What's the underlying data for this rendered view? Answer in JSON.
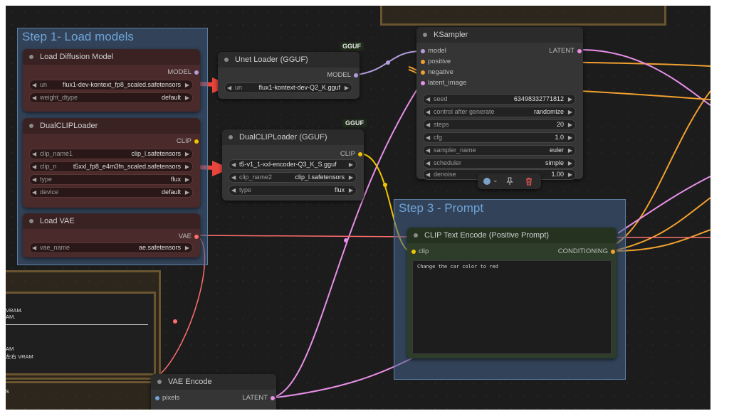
{
  "groups": {
    "step1": "Step 1- Load models",
    "step3": "Step 3 - Prompt"
  },
  "load_diffusion": {
    "title": "Load Diffusion Model",
    "output": "MODEL",
    "unet_label": "un",
    "unet_value": "flux1-dev-kontext_fp8_scaled.safetensors",
    "dtype_label": "weight_dtype",
    "dtype_value": "default"
  },
  "dualclip": {
    "title": "DualCLIPLoader",
    "output": "CLIP",
    "clip1_label": "clip_name1",
    "clip1_value": "clip_l.safetensors",
    "clip2_label": "clip_n",
    "clip2_value": "t5xxl_fp8_e4m3fn_scaled.safetensors",
    "type_label": "type",
    "type_value": "flux",
    "device_label": "device",
    "device_value": "default"
  },
  "load_vae": {
    "title": "Load VAE",
    "output": "VAE",
    "vae_label": "vae_name",
    "vae_value": "ae.safetensors"
  },
  "unet_gguf": {
    "badge": "GGUF",
    "title": "Unet Loader (GGUF)",
    "output": "MODEL",
    "unet_label": "un",
    "unet_value": "flux1-kontext-dev-Q2_K.gguf"
  },
  "dualclip_gguf": {
    "badge": "GGUF",
    "title": "DualCLIPLoader (GGUF)",
    "output": "CLIP",
    "clip1_value": "t5-v1_1-xxl-encoder-Q3_K_S.gguf",
    "clip2_label": "clip_name2",
    "clip2_value": "clip_l.safetensors",
    "type_label": "type",
    "type_value": "flux"
  },
  "ksampler": {
    "title": "KSampler",
    "inputs": [
      "model",
      "positive",
      "negative",
      "latent_image"
    ],
    "output": "LATENT",
    "widgets": [
      {
        "label": "seed",
        "value": "63498332771812"
      },
      {
        "label": "control after generate",
        "value": "randomize"
      },
      {
        "label": "steps",
        "value": "20"
      },
      {
        "label": "cfg",
        "value": "1.0"
      },
      {
        "label": "sampler_name",
        "value": "euler"
      },
      {
        "label": "scheduler",
        "value": "simple"
      },
      {
        "label": "denoise",
        "value": "1.00"
      }
    ]
  },
  "clip_text": {
    "title": "CLIP Text Encode (Positive Prompt)",
    "input": "clip",
    "output": "CONDITIONING",
    "prompt": "Change the car color to red"
  },
  "vae_encode": {
    "title": "VAE Encode",
    "input": "pixels",
    "output": "LATENT"
  },
  "note_fragments": [
    "VRAM.",
    "AM.",
    "AM",
    "左右 VRAM",
    "s"
  ],
  "colors": {
    "model": "#b39ddb",
    "clip": "#f0c400",
    "vae": "#ff6e6e",
    "latent": "#e88fe8",
    "conditioning": "#f0a030",
    "arrow": "#e8453c"
  },
  "icons": {
    "color_picker": "color-circle-icon",
    "pin": "pin-icon",
    "delete": "trash-icon"
  }
}
